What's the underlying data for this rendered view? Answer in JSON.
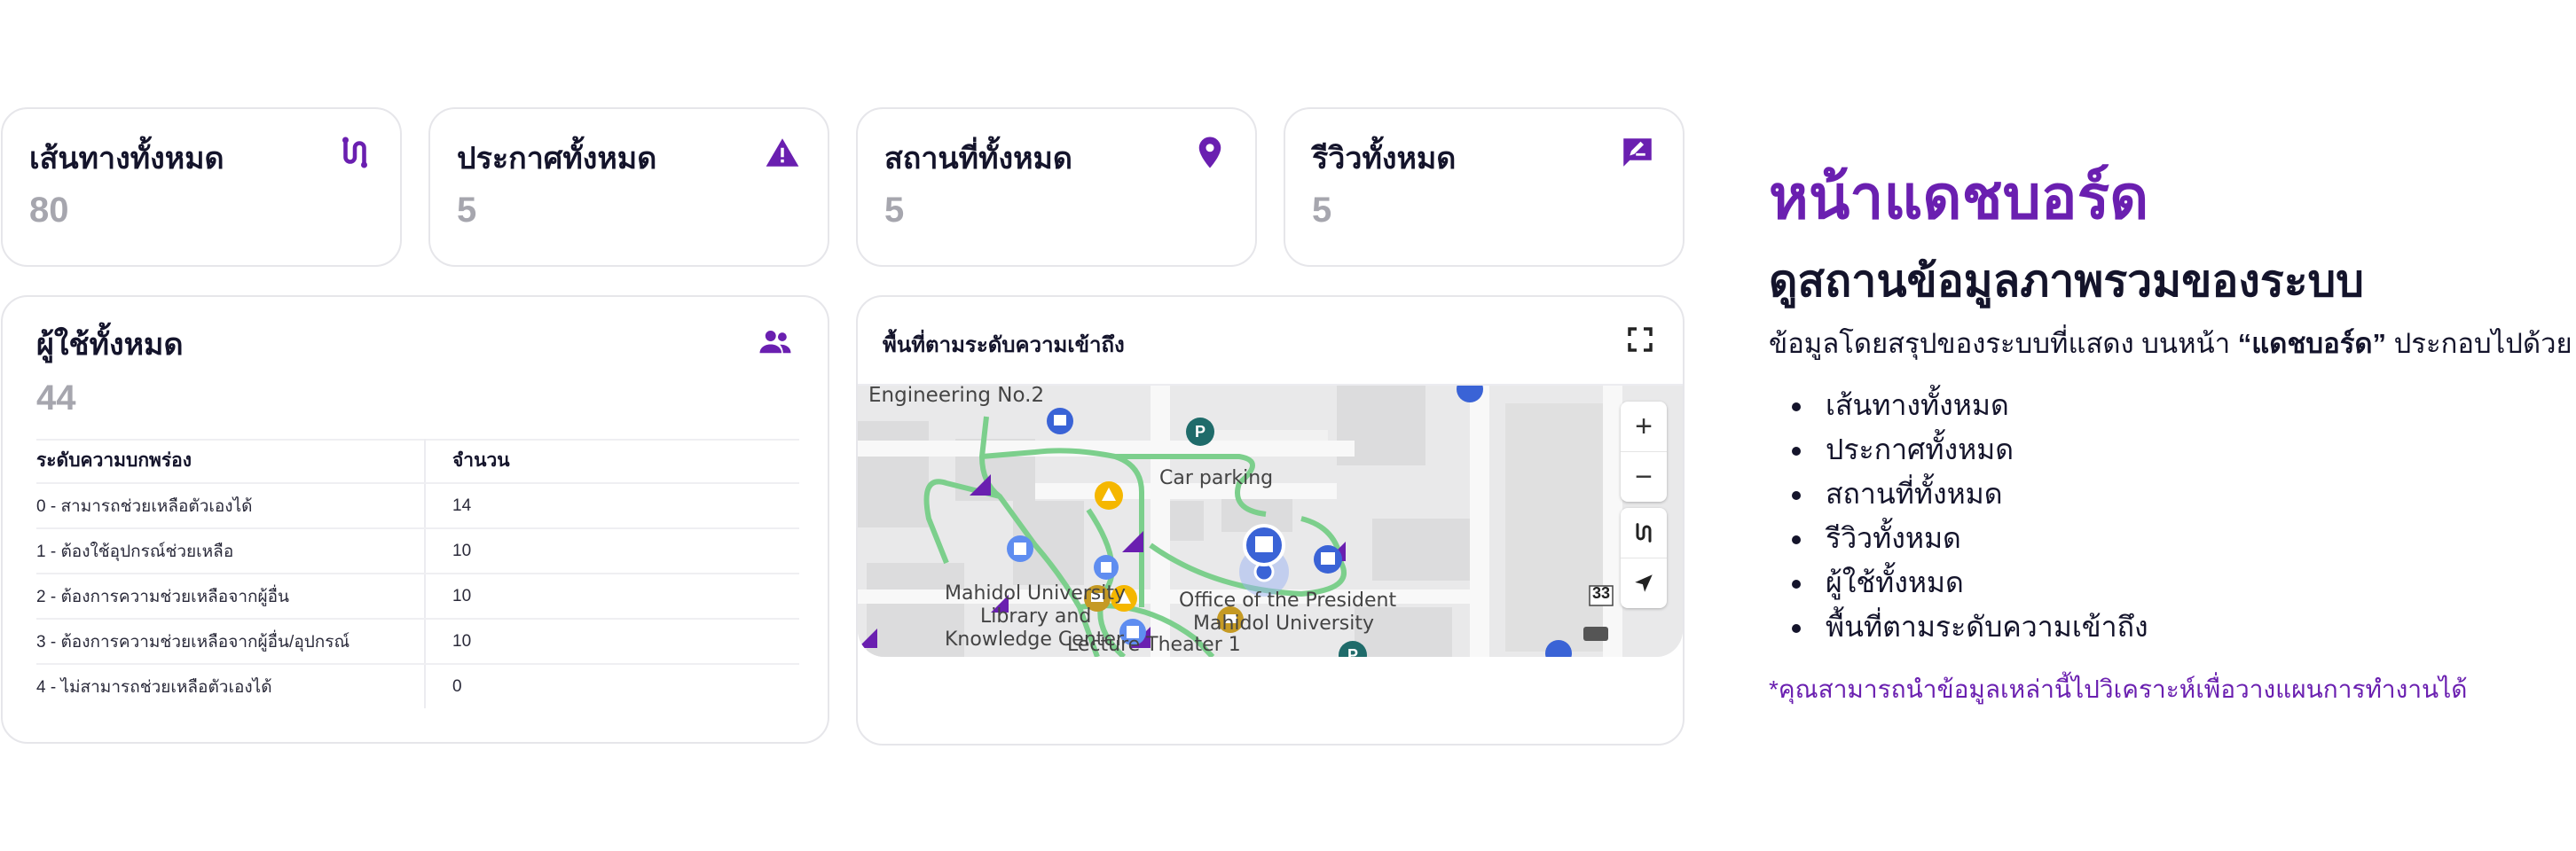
{
  "stats": [
    {
      "title": "เส้นทางทั้งหมด",
      "value": "80",
      "icon": "route-icon"
    },
    {
      "title": "ประกาศทั้งหมด",
      "value": "5",
      "icon": "warning-icon"
    },
    {
      "title": "สถานที่ทั้งหมด",
      "value": "5",
      "icon": "location-pin-icon"
    },
    {
      "title": "รีวิวทั้งหมด",
      "value": "5",
      "icon": "review-edit-icon"
    }
  ],
  "users": {
    "title": "ผู้ใช้ทั้งหมด",
    "value": "44",
    "icon": "users-icon",
    "table": {
      "headers": [
        "ระดับความบกพร่อง",
        "จำนวน"
      ],
      "rows": [
        [
          "0 - สามารถช่วยเหลือตัวเองได้",
          "14"
        ],
        [
          "1 - ต้องใช้อุปกรณ์ช่วยเหลือ",
          "10"
        ],
        [
          "2 - ต้องการความช่วยเหลือจากผู้อื่น",
          "10"
        ],
        [
          "3 - ต้องการความช่วยเหลือจากผู้อื่น/อุปกรณ์",
          "10"
        ],
        [
          "4 - ไม่สามารถช่วยเหลือตัวเองได้",
          "0"
        ]
      ]
    }
  },
  "map": {
    "title": "พื้นที่ตามระดับความเข้าถึง",
    "labels": {
      "engineering": "Engineering No.2",
      "car_parking": "Car parking",
      "library_1": "Mahidol University",
      "library_2": "Library and",
      "library_3": "Knowledge Center",
      "president_1": "Office of the President",
      "president_2": "Mahidol University",
      "lecture": "Lecture Theater 1",
      "road_number": "33"
    },
    "controls": {
      "zoom_in": "+",
      "zoom_out": "−"
    },
    "colors": {
      "route": "#7ccf8c",
      "accent": "#6a1fb0",
      "pin_blue": "#3a63d6",
      "pin_teal": "#1f6b6a",
      "warning": "#f5b700"
    }
  },
  "info": {
    "title": "หน้าแดชบอร์ด",
    "subtitle": "ดูสถานข้อมูลภาพรวมของระบบ",
    "desc_before": "ข้อมูลโดยสรุปของระบบที่แสดง บนหน้า ",
    "desc_bold": "“แดชบอร์ด”",
    "desc_after": " ประกอบไปด้วย",
    "items": [
      "เส้นทางทั้งหมด",
      "ประกาศทั้งหมด",
      "สถานที่ทั้งหมด",
      "รีวิวทั้งหมด",
      "ผู้ใช้ทั้งหมด",
      "พื้นที่ตามระดับความเข้าถึง"
    ],
    "note": "*คุณสามารถนำข้อมูลเหล่านี้ไปวิเคราะห์เพื่อวางแผนการทำงานได้"
  },
  "accent_color": "#6a1fb0"
}
